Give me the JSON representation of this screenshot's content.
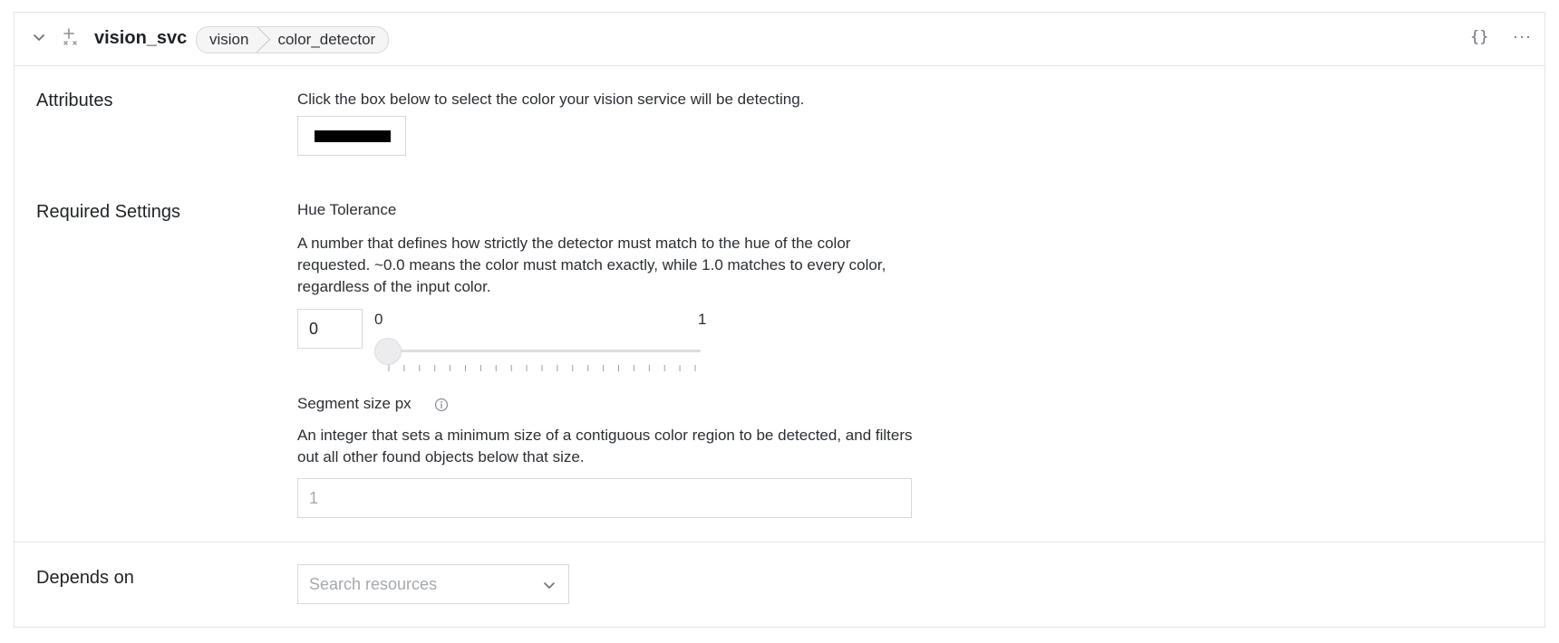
{
  "header": {
    "name": "vision_svc",
    "tags": [
      "vision",
      "color_detector"
    ],
    "json_label": "{}",
    "more_label": "···"
  },
  "attributes": {
    "label": "Attributes",
    "description": "Click the box below to select the color your vision service will be detecting.",
    "selected_color": "#000000"
  },
  "required_settings": {
    "label": "Required Settings",
    "hue_tolerance": {
      "label": "Hue Tolerance",
      "description": "A number that defines how strictly the detector must match to the hue of the color requested. ~0.0 means the color must match exactly, while 1.0 matches to every color, regardless of the input color.",
      "value": "0",
      "slider_min_label": "0",
      "slider_max_label": "1",
      "slider_value": 0
    },
    "segment_size": {
      "label": "Segment size px",
      "description": "An integer that sets a minimum size of a contiguous color region to be detected, and filters out all other found objects below that size.",
      "placeholder": "1"
    }
  },
  "depends_on": {
    "label": "Depends on",
    "placeholder": "Search resources"
  },
  "icons": {
    "collapse": "chevron-down-icon",
    "service": "sparkle-icon",
    "info": "info-icon",
    "select": "chevron-down-icon"
  }
}
